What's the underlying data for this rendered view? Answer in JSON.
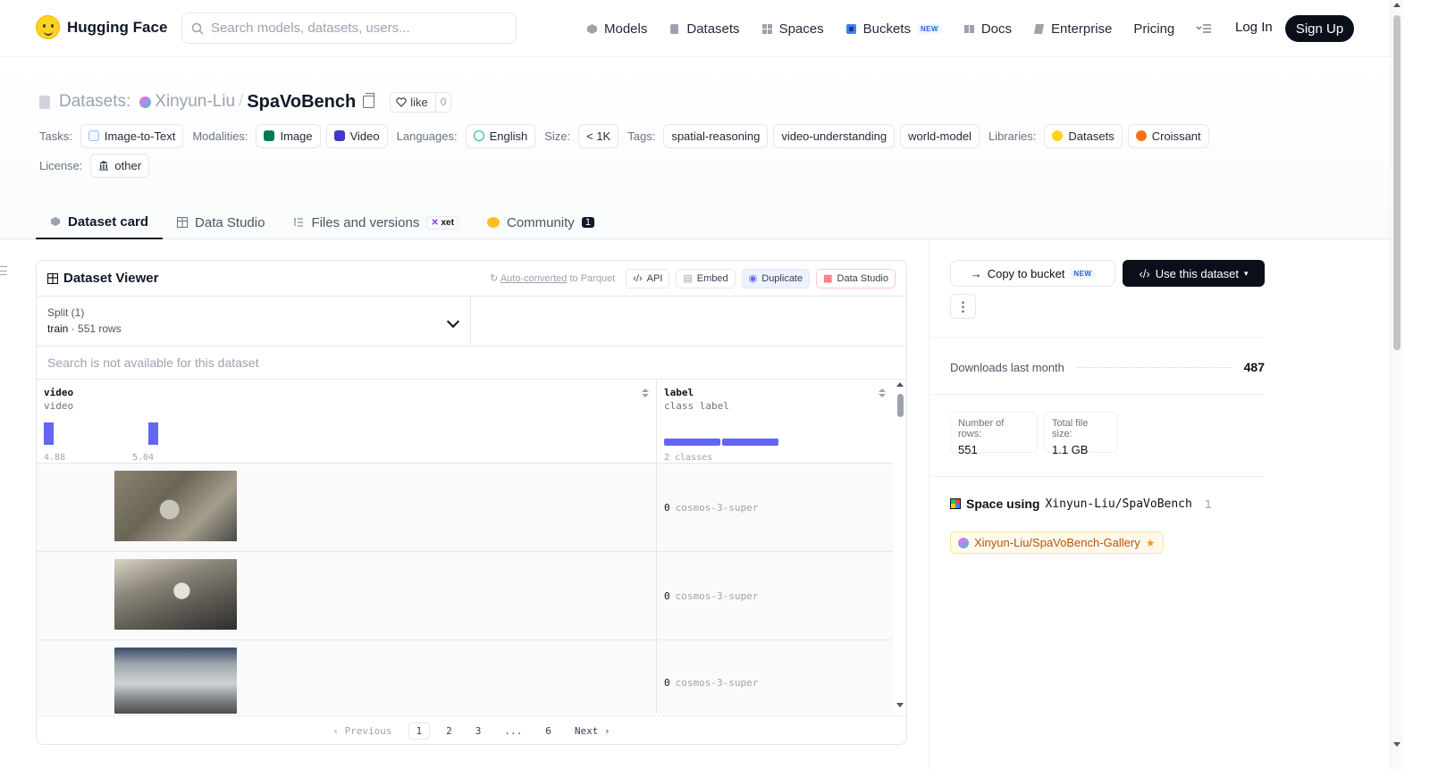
{
  "header": {
    "brand": "Hugging Face",
    "search_placeholder": "Search models, datasets, users...",
    "nav": [
      {
        "label": "Models",
        "icon": "cube-icon"
      },
      {
        "label": "Datasets",
        "icon": "database-icon"
      },
      {
        "label": "Spaces",
        "icon": "grid-icon"
      },
      {
        "label": "Buckets",
        "icon": "bucket-icon",
        "badge": "NEW"
      },
      {
        "label": "Docs",
        "icon": "book-icon"
      },
      {
        "label": "Enterprise",
        "icon": "enterprise-icon"
      },
      {
        "label": "Pricing"
      }
    ],
    "login": "Log In",
    "signup": "Sign Up"
  },
  "repo": {
    "prefix": "Datasets:",
    "user": "Xinyun-Liu",
    "separator": "/",
    "name": "SpaVoBench",
    "like_label": "like",
    "like_count": "0"
  },
  "tags": {
    "tasks_label": "Tasks:",
    "tasks": [
      "Image-to-Text"
    ],
    "modalities_label": "Modalities:",
    "modalities": [
      "Image",
      "Video"
    ],
    "languages_label": "Languages:",
    "languages": [
      "English"
    ],
    "size_label": "Size:",
    "size": "< 1K",
    "tags_label": "Tags:",
    "tags": [
      "spatial-reasoning",
      "video-understanding",
      "world-model"
    ],
    "libraries_label": "Libraries:",
    "libraries": [
      "Datasets",
      "Croissant"
    ],
    "license_label": "License:",
    "license": "other"
  },
  "tabs": [
    {
      "label": "Dataset card",
      "active": true
    },
    {
      "label": "Data Studio"
    },
    {
      "label": "Files and versions",
      "badge": "xet"
    },
    {
      "label": "Community",
      "count": "1"
    }
  ],
  "viewer": {
    "title": "Dataset Viewer",
    "auto_link": "Auto-converted",
    "auto_rest": "to Parquet",
    "buttons": [
      "API",
      "Embed",
      "Duplicate",
      "Data Studio"
    ],
    "split_label": "Split (1)",
    "split_value": "train",
    "split_rows": "551 rows",
    "search_na": "Search is not available for this dataset",
    "columns": [
      {
        "name": "video",
        "type": "video",
        "ticks": [
          "4.88",
          "5.04"
        ],
        "hist": [
          1,
          1
        ]
      },
      {
        "name": "label",
        "type": "class label",
        "summary": "2 classes",
        "class_shares": [
          0.5,
          0.5
        ]
      }
    ],
    "rows": [
      {
        "label_id": "0",
        "label_name": "cosmos-3-super"
      },
      {
        "label_id": "0",
        "label_name": "cosmos-3-super"
      },
      {
        "label_id": "0",
        "label_name": "cosmos-3-super"
      }
    ],
    "pager": {
      "prev": "Previous",
      "pages": [
        "1",
        "2",
        "3",
        "...",
        "6"
      ],
      "next": "Next",
      "current": "1"
    }
  },
  "sidebar": {
    "copy_bucket": "Copy to bucket",
    "copy_badge": "NEW",
    "use_dataset": "Use this dataset",
    "more": "⋮",
    "downloads_label": "Downloads last month",
    "downloads": "487",
    "rows_label": "Number of rows:",
    "rows": "551",
    "size_label": "Total file size:",
    "size": "1.1 GB",
    "spaces_label": "Space using",
    "spaces_repo": "Xinyun-Liu/SpaVoBench",
    "spaces_count": "1",
    "space_chip": "Xinyun-Liu/SpaVoBench-Gallery"
  },
  "colors": {
    "accent": "#6366f1",
    "dark": "#0b0f19",
    "brand_yellow": "#ffd21e"
  }
}
